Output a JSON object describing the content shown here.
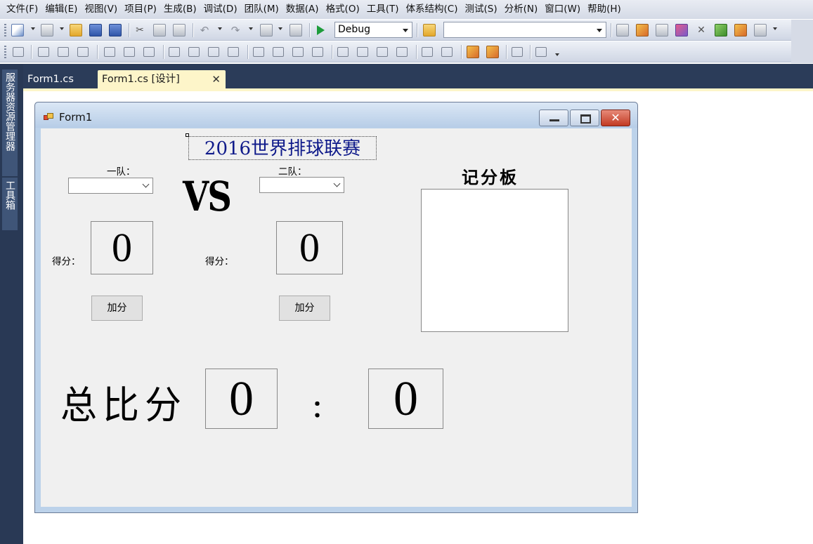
{
  "menu": [
    "文件(F)",
    "编辑(E)",
    "视图(V)",
    "项目(P)",
    "生成(B)",
    "调试(D)",
    "团队(M)",
    "数据(A)",
    "格式(O)",
    "工具(T)",
    "体系结构(C)",
    "测试(S)",
    "分析(N)",
    "窗口(W)",
    "帮助(H)"
  ],
  "toolbar": {
    "config_value": "Debug",
    "search_value": ""
  },
  "tabs": {
    "code": "Form1.cs",
    "design": "Form1.cs [设计]"
  },
  "left_dock": {
    "server_explorer": "服务器资源管理器",
    "toolbox": "工具箱"
  },
  "form": {
    "title": "Form1",
    "headline": "2016世界排球联赛",
    "team1_label": "一队：",
    "team2_label": "二队：",
    "team1_value": "",
    "team2_value": "",
    "vs": "VS",
    "score_label_1": "得分：",
    "score_label_2": "得分：",
    "score1": "0",
    "score2": "0",
    "add_button_1": "加分",
    "add_button_2": "加分",
    "board_title": "记分板",
    "total_label": "总比分",
    "total1": "0",
    "colon": "：",
    "total2": "0"
  }
}
